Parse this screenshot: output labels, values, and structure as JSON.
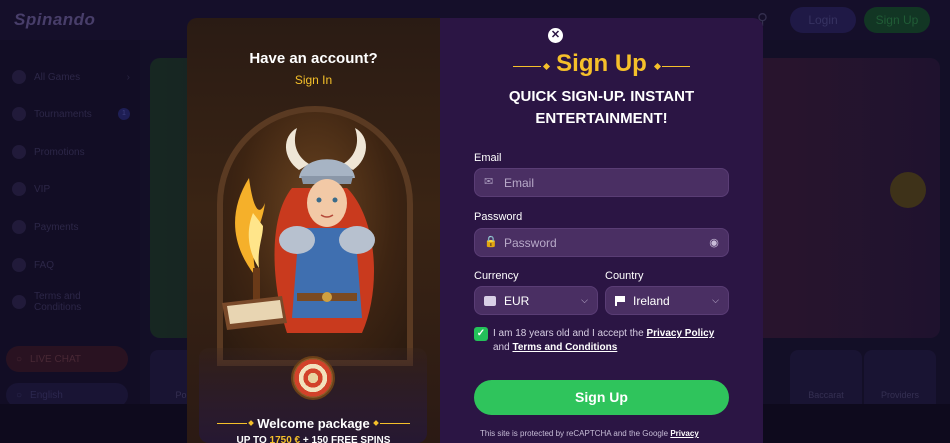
{
  "background": {
    "logo": "Spinando",
    "header": {
      "login_label": "Login",
      "signup_label": "Sign Up"
    },
    "sidebar": {
      "items": [
        {
          "label": "All Games",
          "icon": "cards-icon"
        },
        {
          "label": "Tournaments",
          "icon": "trophy-icon",
          "badge": "1"
        },
        {
          "label": "Promotions",
          "icon": "gift-icon"
        },
        {
          "label": "VIP",
          "icon": "crown-icon"
        },
        {
          "label": "Payments",
          "icon": "wallet-icon"
        },
        {
          "label": "FAQ",
          "icon": "question-icon"
        },
        {
          "label": "Terms and Conditions",
          "icon": "document-icon"
        }
      ],
      "live_chat": "LIVE CHAT",
      "language": "English"
    },
    "tiles": [
      "Popu",
      "Baccarat",
      "Providers"
    ]
  },
  "promo": {
    "have_account": "Have an account?",
    "sign_in": "Sign In",
    "welcome_title": "Welcome package",
    "offer_prefix": "UP TO ",
    "offer_amount": "1750 €",
    "offer_suffix": " + 150 FREE SPINS"
  },
  "form": {
    "title": "Sign Up",
    "subtitle": "QUICK SIGN-UP. INSTANT ENTERTAINMENT!",
    "email": {
      "label": "Email",
      "placeholder": "Email"
    },
    "password": {
      "label": "Password",
      "placeholder": "Password"
    },
    "currency": {
      "label": "Currency",
      "value": "EUR"
    },
    "country": {
      "label": "Country",
      "value": "Ireland"
    },
    "terms": {
      "checked": true,
      "text_1": "I am 18 years old and I accept the ",
      "privacy_link": "Privacy Policy",
      "text_2": " and ",
      "terms_link": "Terms and Conditions"
    },
    "submit_label": "Sign Up",
    "recaptcha_text": "This site is protected by reCAPTCHA and the Google ",
    "recaptcha_link": "Privacy"
  },
  "colors": {
    "accent_yellow": "#f5c02a",
    "cta_green": "#2fc45c",
    "panel_purple": "#2b1544",
    "input_purple": "#4a2f63"
  }
}
